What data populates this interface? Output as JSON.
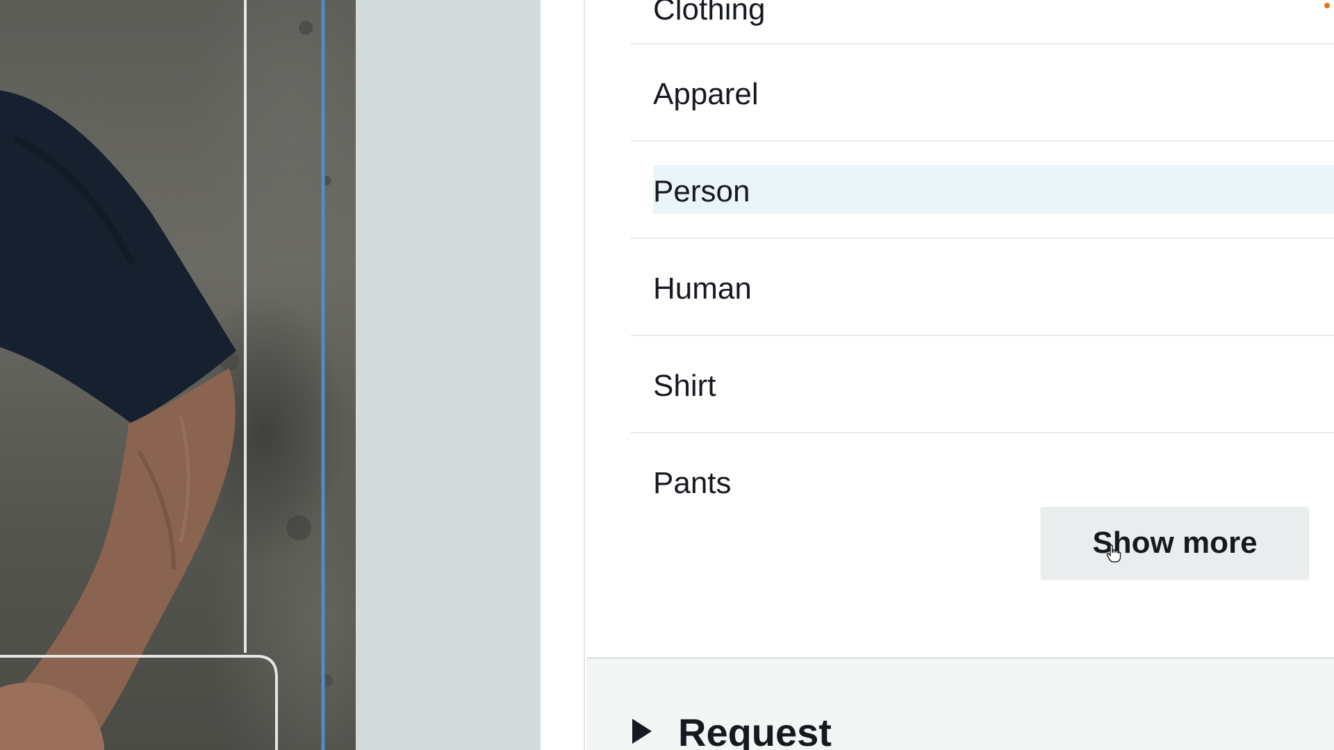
{
  "labels": {
    "items": [
      "Clothing",
      "Apparel",
      "Person",
      "Human",
      "Shirt",
      "Pants"
    ],
    "highlighted": "Person"
  },
  "show_more_button": {
    "label": "Show more"
  },
  "request_section": {
    "title": "Request",
    "expanded": false,
    "caret_icon": "caret-right-icon"
  },
  "colors": {
    "text": "#16191f",
    "highlight": "#eaf5f9",
    "button_bg": "#eaeded",
    "accent": "#ec7211"
  }
}
